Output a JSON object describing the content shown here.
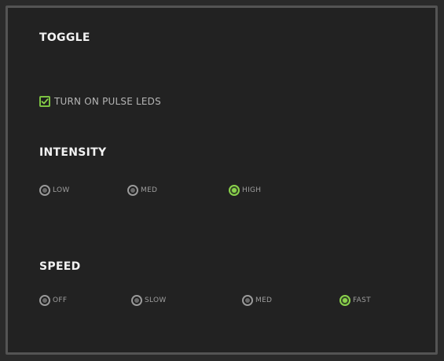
{
  "colors": {
    "accent": "#8ad24c",
    "panel_bg": "#222222",
    "panel_border": "#545454",
    "title_text": "#f2f2f2",
    "label_text": "#b5b5b5"
  },
  "toggle": {
    "title": "TOGGLE",
    "checkbox_label": "TURN ON PULSE LEDS",
    "checked": true,
    "icon": "checkmark-icon"
  },
  "intensity": {
    "title": "INTENSITY",
    "selected": "HIGH",
    "options": [
      {
        "label": "LOW"
      },
      {
        "label": "MED"
      },
      {
        "label": "HIGH"
      }
    ]
  },
  "speed": {
    "title": "SPEED",
    "selected": "FAST",
    "options": [
      {
        "label": "OFF"
      },
      {
        "label": "SLOW"
      },
      {
        "label": "MED"
      },
      {
        "label": "FAST"
      }
    ]
  }
}
